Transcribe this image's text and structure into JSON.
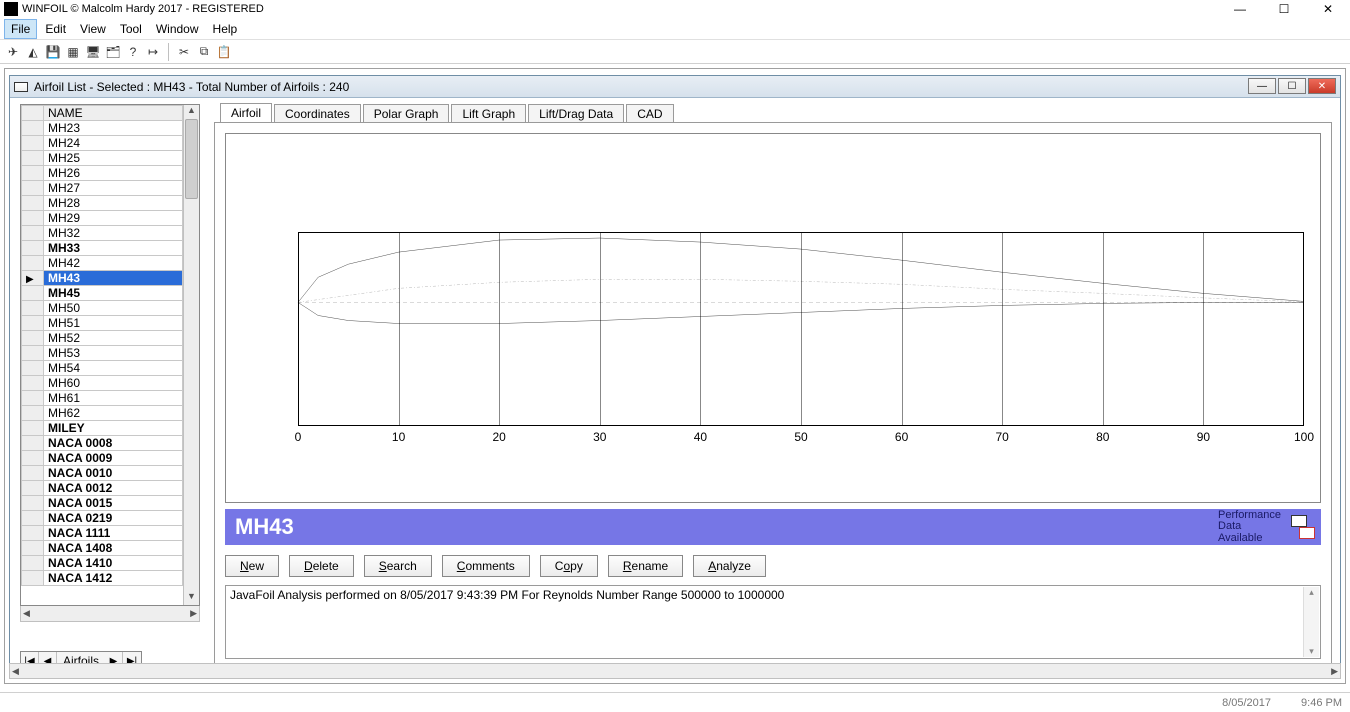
{
  "window": {
    "title": "WINFOIL © Malcolm Hardy 2017 - REGISTERED"
  },
  "menu": {
    "file": "File",
    "edit": "Edit",
    "view": "View",
    "tool": "Tool",
    "window": "Window",
    "help": "Help"
  },
  "child_window": {
    "title": "Airfoil List - Selected : MH43 - Total Number of Airfoils : 240"
  },
  "list": {
    "header": "NAME",
    "items": [
      {
        "name": "MH23",
        "bold": false,
        "sel": false
      },
      {
        "name": "MH24",
        "bold": false,
        "sel": false
      },
      {
        "name": "MH25",
        "bold": false,
        "sel": false
      },
      {
        "name": "MH26",
        "bold": false,
        "sel": false
      },
      {
        "name": "MH27",
        "bold": false,
        "sel": false
      },
      {
        "name": "MH28",
        "bold": false,
        "sel": false
      },
      {
        "name": "MH29",
        "bold": false,
        "sel": false
      },
      {
        "name": "MH32",
        "bold": false,
        "sel": false
      },
      {
        "name": "MH33",
        "bold": true,
        "sel": false
      },
      {
        "name": "MH42",
        "bold": false,
        "sel": false
      },
      {
        "name": "MH43",
        "bold": true,
        "sel": true
      },
      {
        "name": "MH45",
        "bold": true,
        "sel": false
      },
      {
        "name": "MH50",
        "bold": false,
        "sel": false
      },
      {
        "name": "MH51",
        "bold": false,
        "sel": false
      },
      {
        "name": "MH52",
        "bold": false,
        "sel": false
      },
      {
        "name": "MH53",
        "bold": false,
        "sel": false
      },
      {
        "name": "MH54",
        "bold": false,
        "sel": false
      },
      {
        "name": "MH60",
        "bold": false,
        "sel": false
      },
      {
        "name": "MH61",
        "bold": false,
        "sel": false
      },
      {
        "name": "MH62",
        "bold": false,
        "sel": false
      },
      {
        "name": "MILEY",
        "bold": true,
        "sel": false
      },
      {
        "name": "NACA 0008",
        "bold": true,
        "sel": false
      },
      {
        "name": "NACA 0009",
        "bold": true,
        "sel": false
      },
      {
        "name": "NACA 0010",
        "bold": true,
        "sel": false
      },
      {
        "name": "NACA 0012",
        "bold": true,
        "sel": false
      },
      {
        "name": "NACA 0015",
        "bold": true,
        "sel": false
      },
      {
        "name": "NACA 0219",
        "bold": true,
        "sel": false
      },
      {
        "name": "NACA 1111",
        "bold": true,
        "sel": false
      },
      {
        "name": "NACA 1408",
        "bold": true,
        "sel": false
      },
      {
        "name": "NACA 1410",
        "bold": true,
        "sel": false
      },
      {
        "name": "NACA 1412",
        "bold": true,
        "sel": false
      }
    ]
  },
  "nav": {
    "label": "Airfoils"
  },
  "tabs": {
    "airfoil": "Airfoil",
    "coords": "Coordinates",
    "polar": "Polar Graph",
    "lift": "Lift Graph",
    "liftdrag": "Lift/Drag Data",
    "cad": "CAD"
  },
  "chart_data": {
    "type": "line",
    "title": "",
    "xlabel": "",
    "ylabel": "",
    "xlim": [
      0,
      100
    ],
    "x_ticks": [
      0,
      10,
      20,
      30,
      40,
      50,
      60,
      70,
      80,
      90,
      100
    ],
    "series": [
      {
        "name": "upper",
        "x": [
          0,
          2,
          5,
          10,
          20,
          30,
          40,
          50,
          60,
          70,
          80,
          90,
          100
        ],
        "y": [
          0,
          2.5,
          3.8,
          5.0,
          6.2,
          6.4,
          6.0,
          5.3,
          4.2,
          3.0,
          1.9,
          0.9,
          0.1
        ]
      },
      {
        "name": "lower",
        "x": [
          0,
          2,
          5,
          10,
          20,
          30,
          40,
          50,
          60,
          70,
          80,
          90,
          100
        ],
        "y": [
          0,
          -1.3,
          -1.8,
          -2.1,
          -2.1,
          -1.8,
          -1.4,
          -1.0,
          -0.6,
          -0.3,
          -0.1,
          0.0,
          0.0
        ]
      },
      {
        "name": "camber",
        "x": [
          0,
          10,
          20,
          30,
          40,
          50,
          60,
          70,
          80,
          90,
          100
        ],
        "y": [
          0,
          1.4,
          2.0,
          2.3,
          2.3,
          2.1,
          1.8,
          1.3,
          0.9,
          0.45,
          0.05
        ]
      },
      {
        "name": "chord",
        "x": [
          0,
          100
        ],
        "y": [
          0,
          0
        ]
      }
    ]
  },
  "banner": {
    "title": "MH43",
    "perf1": "Performance",
    "perf2": "Data",
    "perf3": "Available"
  },
  "buttons": {
    "new": "New",
    "delete": "Delete",
    "search": "Search",
    "comments": "Comments",
    "copy": "Copy",
    "rename": "Rename",
    "analyze": "Analyze"
  },
  "message": "JavaFoil Analysis performed on 8/05/2017 9:43:39 PM  For Reynolds Number Range 500000 to 1000000",
  "status": {
    "date": "8/05/2017",
    "time": "9:46 PM"
  }
}
